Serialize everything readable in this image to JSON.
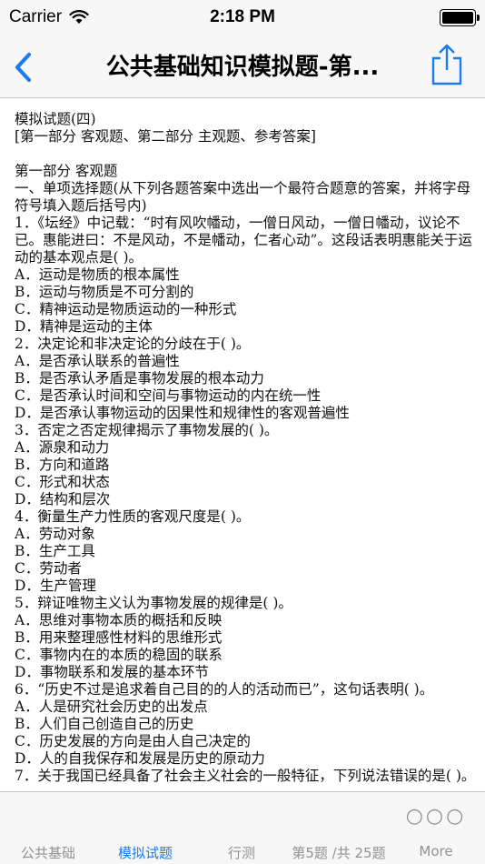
{
  "status_bar": {
    "carrier": "Carrier",
    "time": "2:18 PM"
  },
  "nav": {
    "title": "公共基础知识模拟题-第..."
  },
  "content": {
    "lines": [
      "模拟试题(四)",
      "[第一部分 客观题、第二部分 主观题、参考答案]",
      "",
      "第一部分 客观题",
      "一、单项选择题(从下列各题答案中选出一个最符合题意的答案，并将字母符号填入题后括号内)",
      "1．《坛经》中记载：“时有风吹幡动，一僧日风动，一僧日幡动，议论不已。惠能进曰：不是风动，不是幡动，仁者心动”。这段话表明惠能关于运动的基本观点是( )。",
      "A．运动是物质的根本属性",
      "B．运动与物质是不可分割的",
      "C．精神运动是物质运动的一种形式",
      "D．精神是运动的主体",
      "2．决定论和非决定论的分歧在于( )。",
      "A．是否承认联系的普遍性",
      "B．是否承认矛盾是事物发展的根本动力",
      "C．是否承认时间和空间与事物运动的内在统一性",
      "D．是否承认事物运动的因果性和规律性的客观普遍性",
      "3．否定之否定规律揭示了事物发展的( )。",
      "A．源泉和动力",
      "B．方向和道路",
      "C．形式和状态",
      "D．结构和层次",
      "4．衡量生产力性质的客观尺度是( )。",
      "A．劳动对象",
      "B．生产工具",
      "C．劳动者",
      "D．生产管理",
      "5．辩证唯物主义认为事物发展的规律是( )。",
      "A．思维对事物本质的概括和反映",
      "B．用来整理感性材料的思维形式",
      "C．事物内在的本质的稳固的联系",
      "D．事物联系和发展的基本环节",
      "6．“历史不过是追求着自己目的的人的活动而已”，这句话表明( )。",
      "A．人是研究社会历史的出发点",
      "B．人们自己创造自己的历史",
      "C．历史发展的方向是由人自己决定的",
      "D．人的自我保存和发展是历史的原动力",
      "7．关于我国已经具备了社会主义社会的一般特征，下列说法错误的是( )。"
    ]
  },
  "tabs": [
    {
      "label": "公共基础",
      "active": false
    },
    {
      "label": "模拟试题",
      "active": true
    },
    {
      "label": "行测",
      "active": false
    },
    {
      "label": "第5题 /共 25题",
      "active": false
    },
    {
      "label": "More",
      "active": false
    }
  ],
  "colors": {
    "accent": "#1a7cf5",
    "bar_bg": "#f7f7f7",
    "inactive": "#929292"
  },
  "icons": {
    "back": "chevron-left-icon",
    "share": "share-icon",
    "more": "ellipsis-icon",
    "wifi": "wifi-icon",
    "battery": "battery-icon"
  }
}
